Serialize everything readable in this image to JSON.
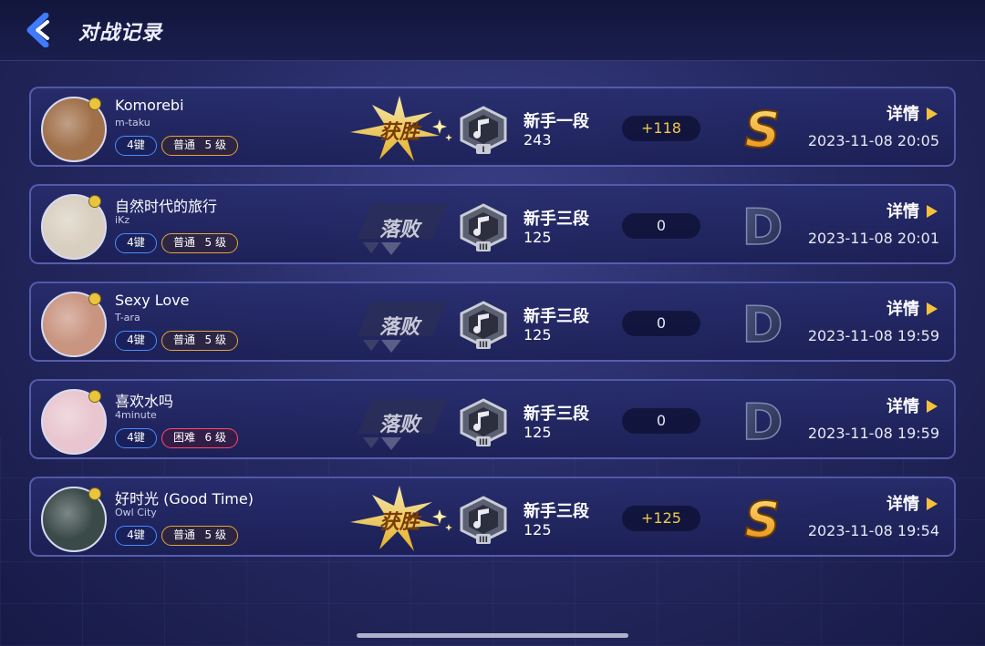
{
  "header": {
    "title": "对战记录",
    "back_icon": "back-chevron-icon"
  },
  "records": [
    {
      "song": "Komorebi",
      "artist": "m-taku",
      "keys": "4键",
      "difficulty": "普通",
      "level": "5 级",
      "difficulty_type": "normal",
      "result": "获胜",
      "result_type": "win",
      "rank_name": "新手一段",
      "rank_tier": "I",
      "rank_score": "243",
      "delta": "+118",
      "grade": "S",
      "detail": "详情",
      "time": "2023-11-08 20:05",
      "cover_color": "#a0704a"
    },
    {
      "song": "自然时代的旅行",
      "artist": "iKz",
      "keys": "4键",
      "difficulty": "普通",
      "level": "5 级",
      "difficulty_type": "normal",
      "result": "落败",
      "result_type": "lose",
      "rank_name": "新手三段",
      "rank_tier": "III",
      "rank_score": "125",
      "delta": "0",
      "grade": "D",
      "detail": "详情",
      "time": "2023-11-08 20:01",
      "cover_color": "#d9cfc0"
    },
    {
      "song": "Sexy Love",
      "artist": "T-ara",
      "keys": "4键",
      "difficulty": "普通",
      "level": "5 级",
      "difficulty_type": "normal",
      "result": "落败",
      "result_type": "lose",
      "rank_name": "新手三段",
      "rank_tier": "III",
      "rank_score": "125",
      "delta": "0",
      "grade": "D",
      "detail": "详情",
      "time": "2023-11-08 19:59",
      "cover_color": "#c99480"
    },
    {
      "song": "喜欢水吗",
      "artist": "4minute",
      "keys": "4键",
      "difficulty": "困难",
      "level": "6 级",
      "difficulty_type": "hard",
      "result": "落败",
      "result_type": "lose",
      "rank_name": "新手三段",
      "rank_tier": "III",
      "rank_score": "125",
      "delta": "0",
      "grade": "D",
      "detail": "详情",
      "time": "2023-11-08 19:59",
      "cover_color": "#e9c6cf"
    },
    {
      "song": "好时光 (Good Time)",
      "artist": "Owl City",
      "keys": "4键",
      "difficulty": "普通",
      "level": "5 级",
      "difficulty_type": "normal",
      "result": "获胜",
      "result_type": "win",
      "rank_name": "新手三段",
      "rank_tier": "III",
      "rank_score": "125",
      "delta": "+125",
      "grade": "S",
      "detail": "详情",
      "time": "2023-11-08 19:54",
      "cover_color": "#3a4a48"
    }
  ],
  "colors": {
    "gold": "#f2c94c",
    "keys_border": "#4b8cff",
    "normal_border": "#e3a43c",
    "hard_border": "#ff4a6a"
  }
}
